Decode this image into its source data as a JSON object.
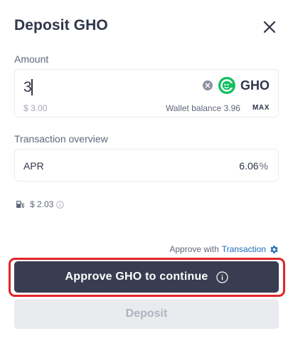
{
  "modal": {
    "title": "Deposit GHO"
  },
  "amount": {
    "label": "Amount",
    "value": "3",
    "usd_value": "$ 3.00",
    "token_symbol": "GHO",
    "wallet_balance": "Wallet balance 3.96",
    "max_label": "MAX"
  },
  "overview": {
    "label": "Transaction overview",
    "apr_label": "APR",
    "apr_value": "6.06",
    "apr_unit": "%"
  },
  "gas": {
    "value": "$ 2.03"
  },
  "approve_with": {
    "prefix": "Approve with",
    "link": "Transaction"
  },
  "buttons": {
    "approve_label": "Approve GHO to continue",
    "deposit_label": "Deposit"
  },
  "colors": {
    "primary_dark": "#383d51",
    "token_green": "#11c060",
    "link_blue": "#1d6cb9",
    "highlight_red": "#e0262a"
  },
  "icons": {
    "close": "close-icon",
    "clear": "clear-circle-icon",
    "token": "gho-token-icon",
    "gas": "gas-pump-icon",
    "gas_info": "info-circle-icon",
    "settings": "gear-icon",
    "approve_info": "info-circle-icon"
  }
}
